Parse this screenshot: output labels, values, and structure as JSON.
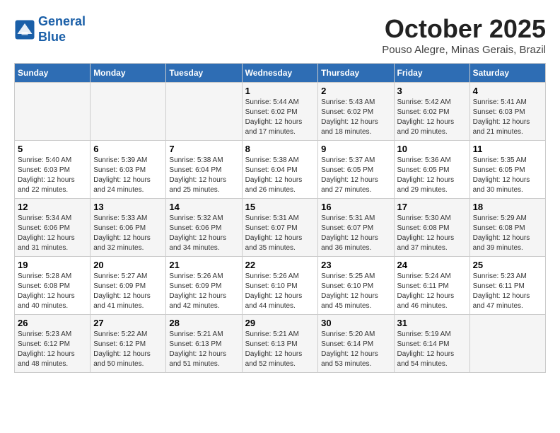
{
  "header": {
    "logo_line1": "General",
    "logo_line2": "Blue",
    "month": "October 2025",
    "location": "Pouso Alegre, Minas Gerais, Brazil"
  },
  "weekdays": [
    "Sunday",
    "Monday",
    "Tuesday",
    "Wednesday",
    "Thursday",
    "Friday",
    "Saturday"
  ],
  "weeks": [
    [
      {
        "day": "",
        "info": ""
      },
      {
        "day": "",
        "info": ""
      },
      {
        "day": "",
        "info": ""
      },
      {
        "day": "1",
        "info": "Sunrise: 5:44 AM\nSunset: 6:02 PM\nDaylight: 12 hours and 17 minutes."
      },
      {
        "day": "2",
        "info": "Sunrise: 5:43 AM\nSunset: 6:02 PM\nDaylight: 12 hours and 18 minutes."
      },
      {
        "day": "3",
        "info": "Sunrise: 5:42 AM\nSunset: 6:02 PM\nDaylight: 12 hours and 20 minutes."
      },
      {
        "day": "4",
        "info": "Sunrise: 5:41 AM\nSunset: 6:03 PM\nDaylight: 12 hours and 21 minutes."
      }
    ],
    [
      {
        "day": "5",
        "info": "Sunrise: 5:40 AM\nSunset: 6:03 PM\nDaylight: 12 hours and 22 minutes."
      },
      {
        "day": "6",
        "info": "Sunrise: 5:39 AM\nSunset: 6:03 PM\nDaylight: 12 hours and 24 minutes."
      },
      {
        "day": "7",
        "info": "Sunrise: 5:38 AM\nSunset: 6:04 PM\nDaylight: 12 hours and 25 minutes."
      },
      {
        "day": "8",
        "info": "Sunrise: 5:38 AM\nSunset: 6:04 PM\nDaylight: 12 hours and 26 minutes."
      },
      {
        "day": "9",
        "info": "Sunrise: 5:37 AM\nSunset: 6:05 PM\nDaylight: 12 hours and 27 minutes."
      },
      {
        "day": "10",
        "info": "Sunrise: 5:36 AM\nSunset: 6:05 PM\nDaylight: 12 hours and 29 minutes."
      },
      {
        "day": "11",
        "info": "Sunrise: 5:35 AM\nSunset: 6:05 PM\nDaylight: 12 hours and 30 minutes."
      }
    ],
    [
      {
        "day": "12",
        "info": "Sunrise: 5:34 AM\nSunset: 6:06 PM\nDaylight: 12 hours and 31 minutes."
      },
      {
        "day": "13",
        "info": "Sunrise: 5:33 AM\nSunset: 6:06 PM\nDaylight: 12 hours and 32 minutes."
      },
      {
        "day": "14",
        "info": "Sunrise: 5:32 AM\nSunset: 6:06 PM\nDaylight: 12 hours and 34 minutes."
      },
      {
        "day": "15",
        "info": "Sunrise: 5:31 AM\nSunset: 6:07 PM\nDaylight: 12 hours and 35 minutes."
      },
      {
        "day": "16",
        "info": "Sunrise: 5:31 AM\nSunset: 6:07 PM\nDaylight: 12 hours and 36 minutes."
      },
      {
        "day": "17",
        "info": "Sunrise: 5:30 AM\nSunset: 6:08 PM\nDaylight: 12 hours and 37 minutes."
      },
      {
        "day": "18",
        "info": "Sunrise: 5:29 AM\nSunset: 6:08 PM\nDaylight: 12 hours and 39 minutes."
      }
    ],
    [
      {
        "day": "19",
        "info": "Sunrise: 5:28 AM\nSunset: 6:08 PM\nDaylight: 12 hours and 40 minutes."
      },
      {
        "day": "20",
        "info": "Sunrise: 5:27 AM\nSunset: 6:09 PM\nDaylight: 12 hours and 41 minutes."
      },
      {
        "day": "21",
        "info": "Sunrise: 5:26 AM\nSunset: 6:09 PM\nDaylight: 12 hours and 42 minutes."
      },
      {
        "day": "22",
        "info": "Sunrise: 5:26 AM\nSunset: 6:10 PM\nDaylight: 12 hours and 44 minutes."
      },
      {
        "day": "23",
        "info": "Sunrise: 5:25 AM\nSunset: 6:10 PM\nDaylight: 12 hours and 45 minutes."
      },
      {
        "day": "24",
        "info": "Sunrise: 5:24 AM\nSunset: 6:11 PM\nDaylight: 12 hours and 46 minutes."
      },
      {
        "day": "25",
        "info": "Sunrise: 5:23 AM\nSunset: 6:11 PM\nDaylight: 12 hours and 47 minutes."
      }
    ],
    [
      {
        "day": "26",
        "info": "Sunrise: 5:23 AM\nSunset: 6:12 PM\nDaylight: 12 hours and 48 minutes."
      },
      {
        "day": "27",
        "info": "Sunrise: 5:22 AM\nSunset: 6:12 PM\nDaylight: 12 hours and 50 minutes."
      },
      {
        "day": "28",
        "info": "Sunrise: 5:21 AM\nSunset: 6:13 PM\nDaylight: 12 hours and 51 minutes."
      },
      {
        "day": "29",
        "info": "Sunrise: 5:21 AM\nSunset: 6:13 PM\nDaylight: 12 hours and 52 minutes."
      },
      {
        "day": "30",
        "info": "Sunrise: 5:20 AM\nSunset: 6:14 PM\nDaylight: 12 hours and 53 minutes."
      },
      {
        "day": "31",
        "info": "Sunrise: 5:19 AM\nSunset: 6:14 PM\nDaylight: 12 hours and 54 minutes."
      },
      {
        "day": "",
        "info": ""
      }
    ]
  ]
}
